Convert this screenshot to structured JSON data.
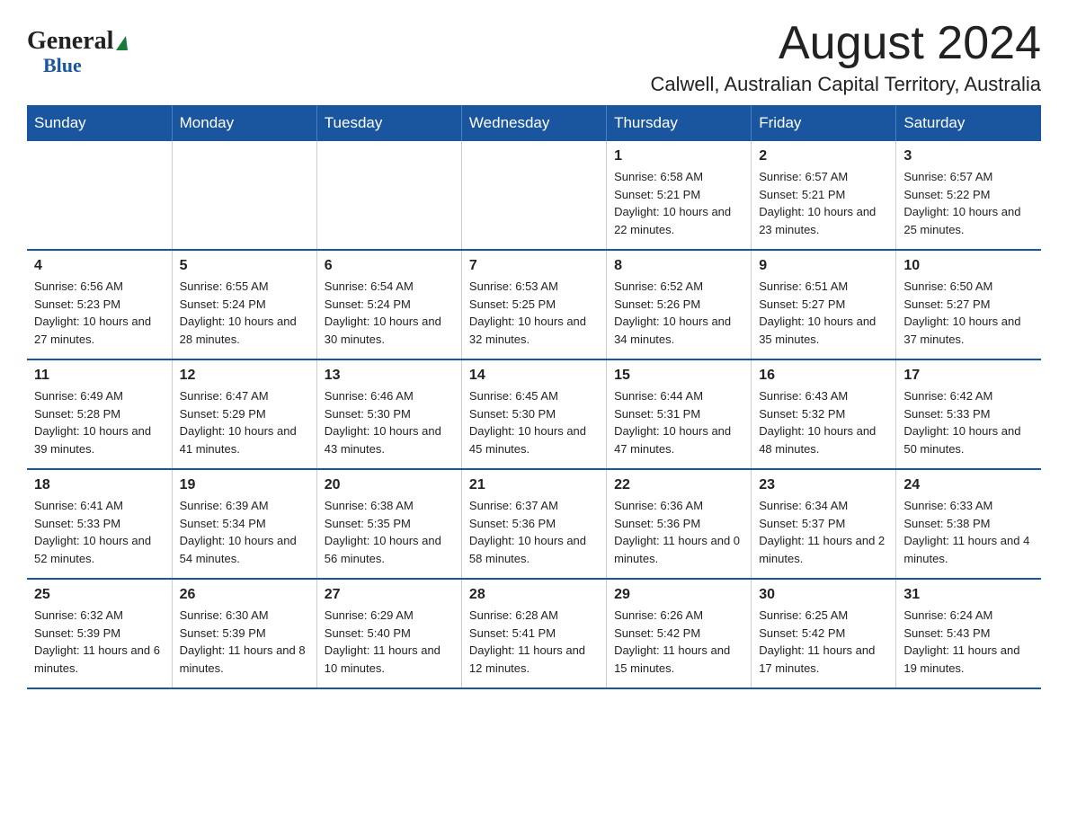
{
  "header": {
    "logo_general": "General",
    "logo_blue": "Blue",
    "month_title": "August 2024",
    "location": "Calwell, Australian Capital Territory, Australia"
  },
  "days_of_week": [
    "Sunday",
    "Monday",
    "Tuesday",
    "Wednesday",
    "Thursday",
    "Friday",
    "Saturday"
  ],
  "weeks": [
    {
      "days": [
        {
          "number": "",
          "info": ""
        },
        {
          "number": "",
          "info": ""
        },
        {
          "number": "",
          "info": ""
        },
        {
          "number": "",
          "info": ""
        },
        {
          "number": "1",
          "info": "Sunrise: 6:58 AM\nSunset: 5:21 PM\nDaylight: 10 hours and 22 minutes."
        },
        {
          "number": "2",
          "info": "Sunrise: 6:57 AM\nSunset: 5:21 PM\nDaylight: 10 hours and 23 minutes."
        },
        {
          "number": "3",
          "info": "Sunrise: 6:57 AM\nSunset: 5:22 PM\nDaylight: 10 hours and 25 minutes."
        }
      ]
    },
    {
      "days": [
        {
          "number": "4",
          "info": "Sunrise: 6:56 AM\nSunset: 5:23 PM\nDaylight: 10 hours and 27 minutes."
        },
        {
          "number": "5",
          "info": "Sunrise: 6:55 AM\nSunset: 5:24 PM\nDaylight: 10 hours and 28 minutes."
        },
        {
          "number": "6",
          "info": "Sunrise: 6:54 AM\nSunset: 5:24 PM\nDaylight: 10 hours and 30 minutes."
        },
        {
          "number": "7",
          "info": "Sunrise: 6:53 AM\nSunset: 5:25 PM\nDaylight: 10 hours and 32 minutes."
        },
        {
          "number": "8",
          "info": "Sunrise: 6:52 AM\nSunset: 5:26 PM\nDaylight: 10 hours and 34 minutes."
        },
        {
          "number": "9",
          "info": "Sunrise: 6:51 AM\nSunset: 5:27 PM\nDaylight: 10 hours and 35 minutes."
        },
        {
          "number": "10",
          "info": "Sunrise: 6:50 AM\nSunset: 5:27 PM\nDaylight: 10 hours and 37 minutes."
        }
      ]
    },
    {
      "days": [
        {
          "number": "11",
          "info": "Sunrise: 6:49 AM\nSunset: 5:28 PM\nDaylight: 10 hours and 39 minutes."
        },
        {
          "number": "12",
          "info": "Sunrise: 6:47 AM\nSunset: 5:29 PM\nDaylight: 10 hours and 41 minutes."
        },
        {
          "number": "13",
          "info": "Sunrise: 6:46 AM\nSunset: 5:30 PM\nDaylight: 10 hours and 43 minutes."
        },
        {
          "number": "14",
          "info": "Sunrise: 6:45 AM\nSunset: 5:30 PM\nDaylight: 10 hours and 45 minutes."
        },
        {
          "number": "15",
          "info": "Sunrise: 6:44 AM\nSunset: 5:31 PM\nDaylight: 10 hours and 47 minutes."
        },
        {
          "number": "16",
          "info": "Sunrise: 6:43 AM\nSunset: 5:32 PM\nDaylight: 10 hours and 48 minutes."
        },
        {
          "number": "17",
          "info": "Sunrise: 6:42 AM\nSunset: 5:33 PM\nDaylight: 10 hours and 50 minutes."
        }
      ]
    },
    {
      "days": [
        {
          "number": "18",
          "info": "Sunrise: 6:41 AM\nSunset: 5:33 PM\nDaylight: 10 hours and 52 minutes."
        },
        {
          "number": "19",
          "info": "Sunrise: 6:39 AM\nSunset: 5:34 PM\nDaylight: 10 hours and 54 minutes."
        },
        {
          "number": "20",
          "info": "Sunrise: 6:38 AM\nSunset: 5:35 PM\nDaylight: 10 hours and 56 minutes."
        },
        {
          "number": "21",
          "info": "Sunrise: 6:37 AM\nSunset: 5:36 PM\nDaylight: 10 hours and 58 minutes."
        },
        {
          "number": "22",
          "info": "Sunrise: 6:36 AM\nSunset: 5:36 PM\nDaylight: 11 hours and 0 minutes."
        },
        {
          "number": "23",
          "info": "Sunrise: 6:34 AM\nSunset: 5:37 PM\nDaylight: 11 hours and 2 minutes."
        },
        {
          "number": "24",
          "info": "Sunrise: 6:33 AM\nSunset: 5:38 PM\nDaylight: 11 hours and 4 minutes."
        }
      ]
    },
    {
      "days": [
        {
          "number": "25",
          "info": "Sunrise: 6:32 AM\nSunset: 5:39 PM\nDaylight: 11 hours and 6 minutes."
        },
        {
          "number": "26",
          "info": "Sunrise: 6:30 AM\nSunset: 5:39 PM\nDaylight: 11 hours and 8 minutes."
        },
        {
          "number": "27",
          "info": "Sunrise: 6:29 AM\nSunset: 5:40 PM\nDaylight: 11 hours and 10 minutes."
        },
        {
          "number": "28",
          "info": "Sunrise: 6:28 AM\nSunset: 5:41 PM\nDaylight: 11 hours and 12 minutes."
        },
        {
          "number": "29",
          "info": "Sunrise: 6:26 AM\nSunset: 5:42 PM\nDaylight: 11 hours and 15 minutes."
        },
        {
          "number": "30",
          "info": "Sunrise: 6:25 AM\nSunset: 5:42 PM\nDaylight: 11 hours and 17 minutes."
        },
        {
          "number": "31",
          "info": "Sunrise: 6:24 AM\nSunset: 5:43 PM\nDaylight: 11 hours and 19 minutes."
        }
      ]
    }
  ]
}
